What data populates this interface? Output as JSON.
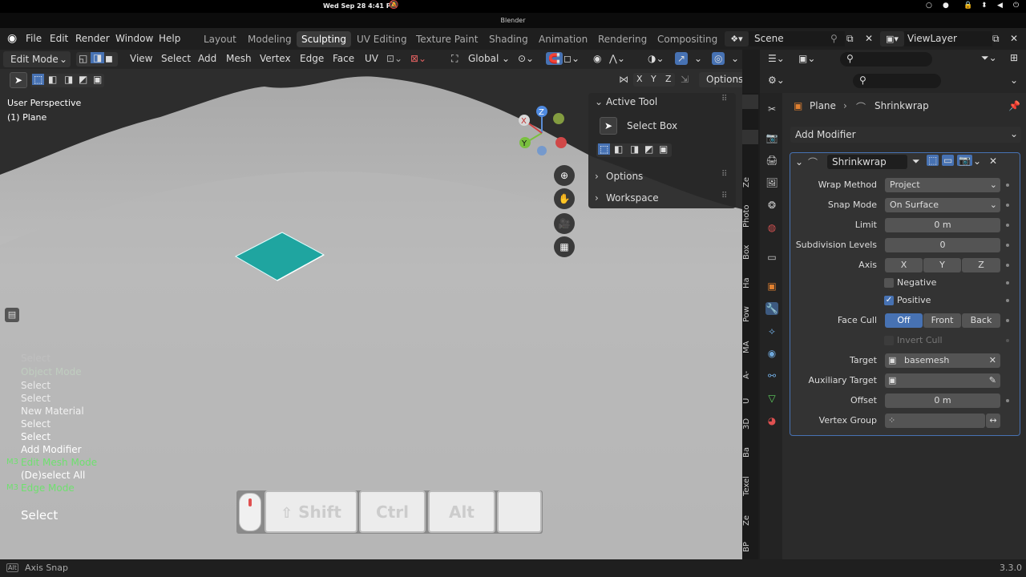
{
  "system": {
    "clock": "Wed Sep 28  4:41 PM"
  },
  "window": {
    "title": "Blender"
  },
  "menu": {
    "items": [
      "File",
      "Edit",
      "Render",
      "Window",
      "Help"
    ]
  },
  "workspaces": [
    "Layout",
    "Modeling",
    "Sculpting",
    "UV Editing",
    "Texture Paint",
    "Shading",
    "Animation",
    "Rendering",
    "Compositing"
  ],
  "active_workspace": "Sculpting",
  "scene": "Scene",
  "view_layer": "ViewLayer",
  "viewport_header": {
    "mode": "Edit Mode",
    "menus": [
      "View",
      "Select",
      "Add",
      "Mesh",
      "Vertex",
      "Edge",
      "Face",
      "UV"
    ],
    "orientation": "Global",
    "options": "Options",
    "axes": [
      "X",
      "Y",
      "Z"
    ]
  },
  "viewport": {
    "perspective": "User Perspective",
    "object": "(1) Plane"
  },
  "gizmo": {
    "x": "X",
    "y": "Y",
    "z": "Z"
  },
  "active_tool": {
    "header": "Active Tool",
    "tool": "Select Box",
    "options": "Options",
    "workspace": "Workspace"
  },
  "side_tabs": [
    "Ze",
    "Photo",
    "Box",
    "Ha",
    "Pow",
    "MA",
    "A-",
    "U",
    "3D",
    "Ba",
    "Texel",
    "Ze",
    "BP"
  ],
  "history": [
    {
      "text": "Select",
      "color": "#d0d0d0"
    },
    {
      "text": "Object Mode",
      "color": "#c8e6c8"
    },
    {
      "text": "Select",
      "color": "#ffffff"
    },
    {
      "text": "Select",
      "color": "#ffffff"
    },
    {
      "text": "New Material",
      "color": "#ffffff"
    },
    {
      "text": "Select",
      "color": "#ffffff"
    },
    {
      "text": "Select",
      "color": "#ffffff"
    },
    {
      "text": "Add Modifier",
      "color": "#ffffff"
    },
    {
      "text": "Edit Mesh Mode",
      "color": "#6fe06f",
      "prefix": "M3"
    },
    {
      "text": "(De)select All",
      "color": "#ffffff"
    },
    {
      "text": "Edge Mode",
      "color": "#6fe06f",
      "prefix": "M3"
    }
  ],
  "last_action": "Select",
  "keys": {
    "shift": "Shift",
    "ctrl": "Ctrl",
    "alt": "Alt"
  },
  "properties": {
    "breadcrumb_object": "Plane",
    "breadcrumb_modifier": "Shrinkwrap",
    "add_modifier": "Add Modifier",
    "modifier_name": "Shrinkwrap",
    "wrap_method_label": "Wrap Method",
    "wrap_method": "Project",
    "snap_mode_label": "Snap Mode",
    "snap_mode": "On Surface",
    "limit_label": "Limit",
    "limit": "0 m",
    "subdiv_label": "Subdivision Levels",
    "subdiv": "0",
    "axis_label": "Axis",
    "axis_x": "X",
    "axis_y": "Y",
    "axis_z": "Z",
    "negative": "Negative",
    "positive": "Positive",
    "face_cull_label": "Face Cull",
    "cull_off": "Off",
    "cull_front": "Front",
    "cull_back": "Back",
    "invert_cull": "Invert Cull",
    "target_label": "Target",
    "target": "basemesh",
    "aux_target_label": "Auxiliary Target",
    "offset_label": "Offset",
    "offset": "0 m",
    "vertex_group_label": "Vertex Group"
  },
  "status": {
    "hint": "Axis Snap",
    "version": "3.3.0",
    "key": "Alt"
  }
}
